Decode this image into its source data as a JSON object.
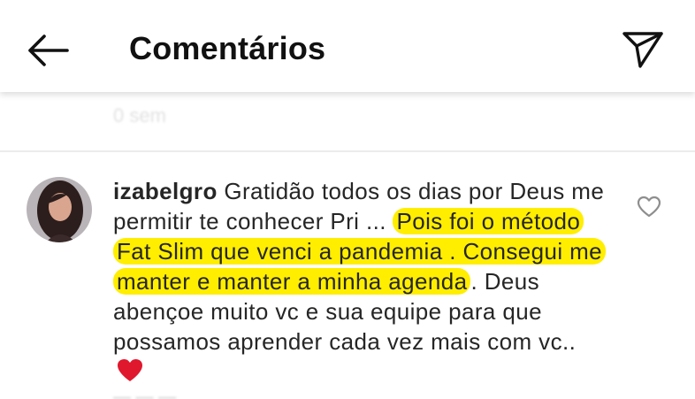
{
  "header": {
    "title": "Comentários",
    "back_icon": "arrow-left-icon",
    "share_icon": "paper-plane-icon"
  },
  "previous_comment": {
    "faded_text": "0 sem"
  },
  "comment": {
    "username": "izabelgro",
    "text_plain_before": "Gratidão todos os dias por Deus me permitir te conhecer Pri ...",
    "text_highlighted": "Pois foi o método Fat Slim que venci a pandemia . Consegui me manter e manter a minha agenda",
    "text_plain_after": ". Deus abençoe muito vc e sua equipe para que possamos aprender cada vez mais com vc..",
    "emoji": "red-heart-emoji",
    "like_icon": "heart-outline-icon",
    "meta_faded": "— — —"
  },
  "colors": {
    "highlight": "#ffee00",
    "text": "#262626",
    "heart_emoji": "#e0182d",
    "divider": "#ececec"
  }
}
